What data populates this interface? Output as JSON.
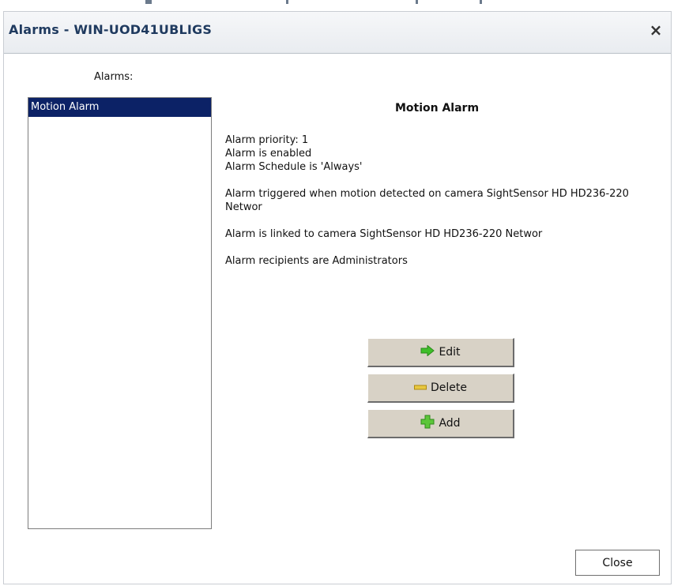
{
  "window": {
    "title": "Alarms - WIN-UOD41UBLIGS",
    "close_glyph": "×"
  },
  "sidebar": {
    "label": "Alarms:",
    "items": [
      {
        "label": "Motion Alarm",
        "selected": true
      }
    ]
  },
  "detail": {
    "title": "Motion Alarm",
    "lines": [
      "Alarm priority: 1",
      "Alarm is enabled",
      "Alarm Schedule is 'Always'",
      "Alarm triggered when motion detected on camera SightSensor HD HD236-220 Networ",
      "Alarm is linked to camera SightSensor HD HD236-220 Networ",
      "Alarm recipients are Administrators"
    ]
  },
  "actions": {
    "edit_label": "Edit",
    "delete_label": "Delete",
    "add_label": "Add",
    "edit_icon": "green-arrow-icon",
    "delete_icon": "minus-icon",
    "add_icon": "plus-icon"
  },
  "footer": {
    "close_label": "Close"
  },
  "colors": {
    "title_text": "#1f3a5f",
    "selection_bg": "#0c2266",
    "button_face": "#d8d2c6",
    "edit_icon_green": "#3fbf2a",
    "delete_icon_yellow": "#e8c840",
    "add_icon_green": "#5cc63a"
  }
}
